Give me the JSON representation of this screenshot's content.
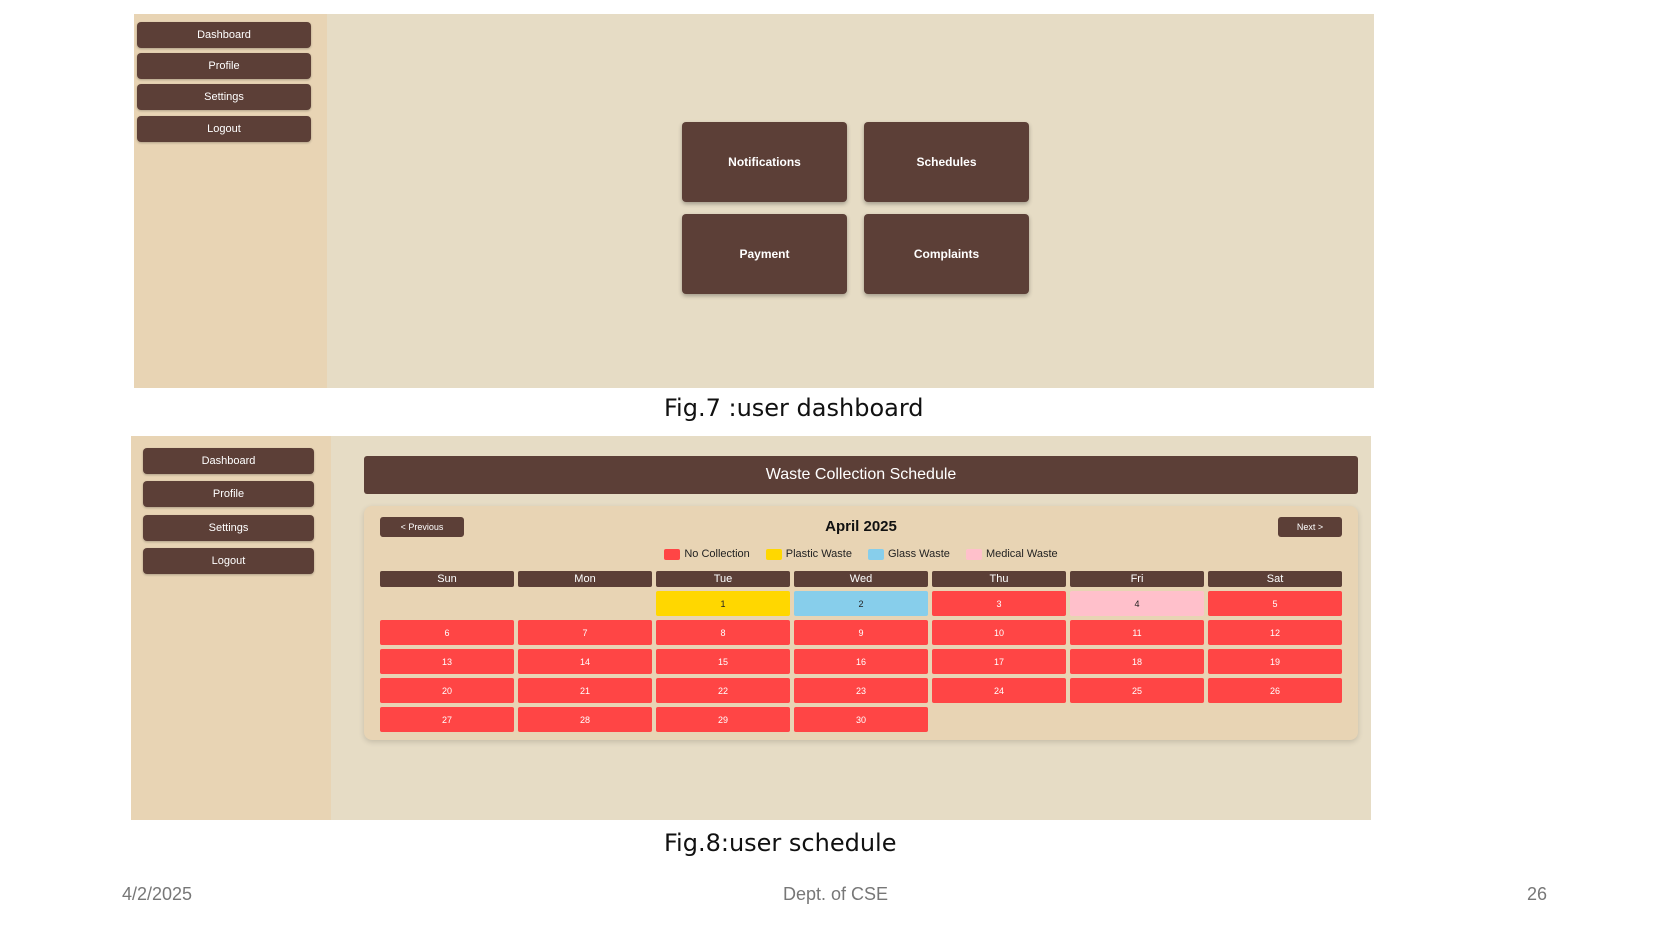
{
  "fig7": {
    "sidebar": [
      "Dashboard",
      "Profile",
      "Settings",
      "Logout"
    ],
    "tiles": [
      "Notifications",
      "Schedules",
      "Payment",
      "Complaints"
    ],
    "caption": "Fig.7 :user dashboard"
  },
  "fig8": {
    "sidebar": [
      "Dashboard",
      "Profile",
      "Settings",
      "Logout"
    ],
    "header": "Waste Collection Schedule",
    "prev_label": "< Previous",
    "next_label": "Next >",
    "month": "April 2025",
    "legend": [
      {
        "label": "No Collection",
        "color": "#ff4545"
      },
      {
        "label": "Plastic Waste",
        "color": "#ffd700"
      },
      {
        "label": "Glass Waste",
        "color": "#87ceeb"
      },
      {
        "label": "Medical Waste",
        "color": "#ffc0cb"
      }
    ],
    "weekdays": [
      "Sun",
      "Mon",
      "Tue",
      "Wed",
      "Thu",
      "Fri",
      "Sat"
    ],
    "leading_empty": 2,
    "days": [
      {
        "d": "1",
        "type": "plastic"
      },
      {
        "d": "2",
        "type": "glass"
      },
      {
        "d": "3",
        "type": "none"
      },
      {
        "d": "4",
        "type": "medical"
      },
      {
        "d": "5",
        "type": "none"
      },
      {
        "d": "6",
        "type": "none"
      },
      {
        "d": "7",
        "type": "none"
      },
      {
        "d": "8",
        "type": "none"
      },
      {
        "d": "9",
        "type": "none"
      },
      {
        "d": "10",
        "type": "none"
      },
      {
        "d": "11",
        "type": "none"
      },
      {
        "d": "12",
        "type": "none"
      },
      {
        "d": "13",
        "type": "none"
      },
      {
        "d": "14",
        "type": "none"
      },
      {
        "d": "15",
        "type": "none"
      },
      {
        "d": "16",
        "type": "none"
      },
      {
        "d": "17",
        "type": "none"
      },
      {
        "d": "18",
        "type": "none"
      },
      {
        "d": "19",
        "type": "none"
      },
      {
        "d": "20",
        "type": "none"
      },
      {
        "d": "21",
        "type": "none"
      },
      {
        "d": "22",
        "type": "none"
      },
      {
        "d": "23",
        "type": "none"
      },
      {
        "d": "24",
        "type": "none"
      },
      {
        "d": "25",
        "type": "none"
      },
      {
        "d": "26",
        "type": "none"
      },
      {
        "d": "27",
        "type": "none"
      },
      {
        "d": "28",
        "type": "none"
      },
      {
        "d": "29",
        "type": "none"
      },
      {
        "d": "30",
        "type": "none"
      }
    ],
    "caption": "Fig.8:user schedule"
  },
  "footer": {
    "date": "4/2/2025",
    "dept": "Dept. of CSE",
    "page": "26"
  }
}
